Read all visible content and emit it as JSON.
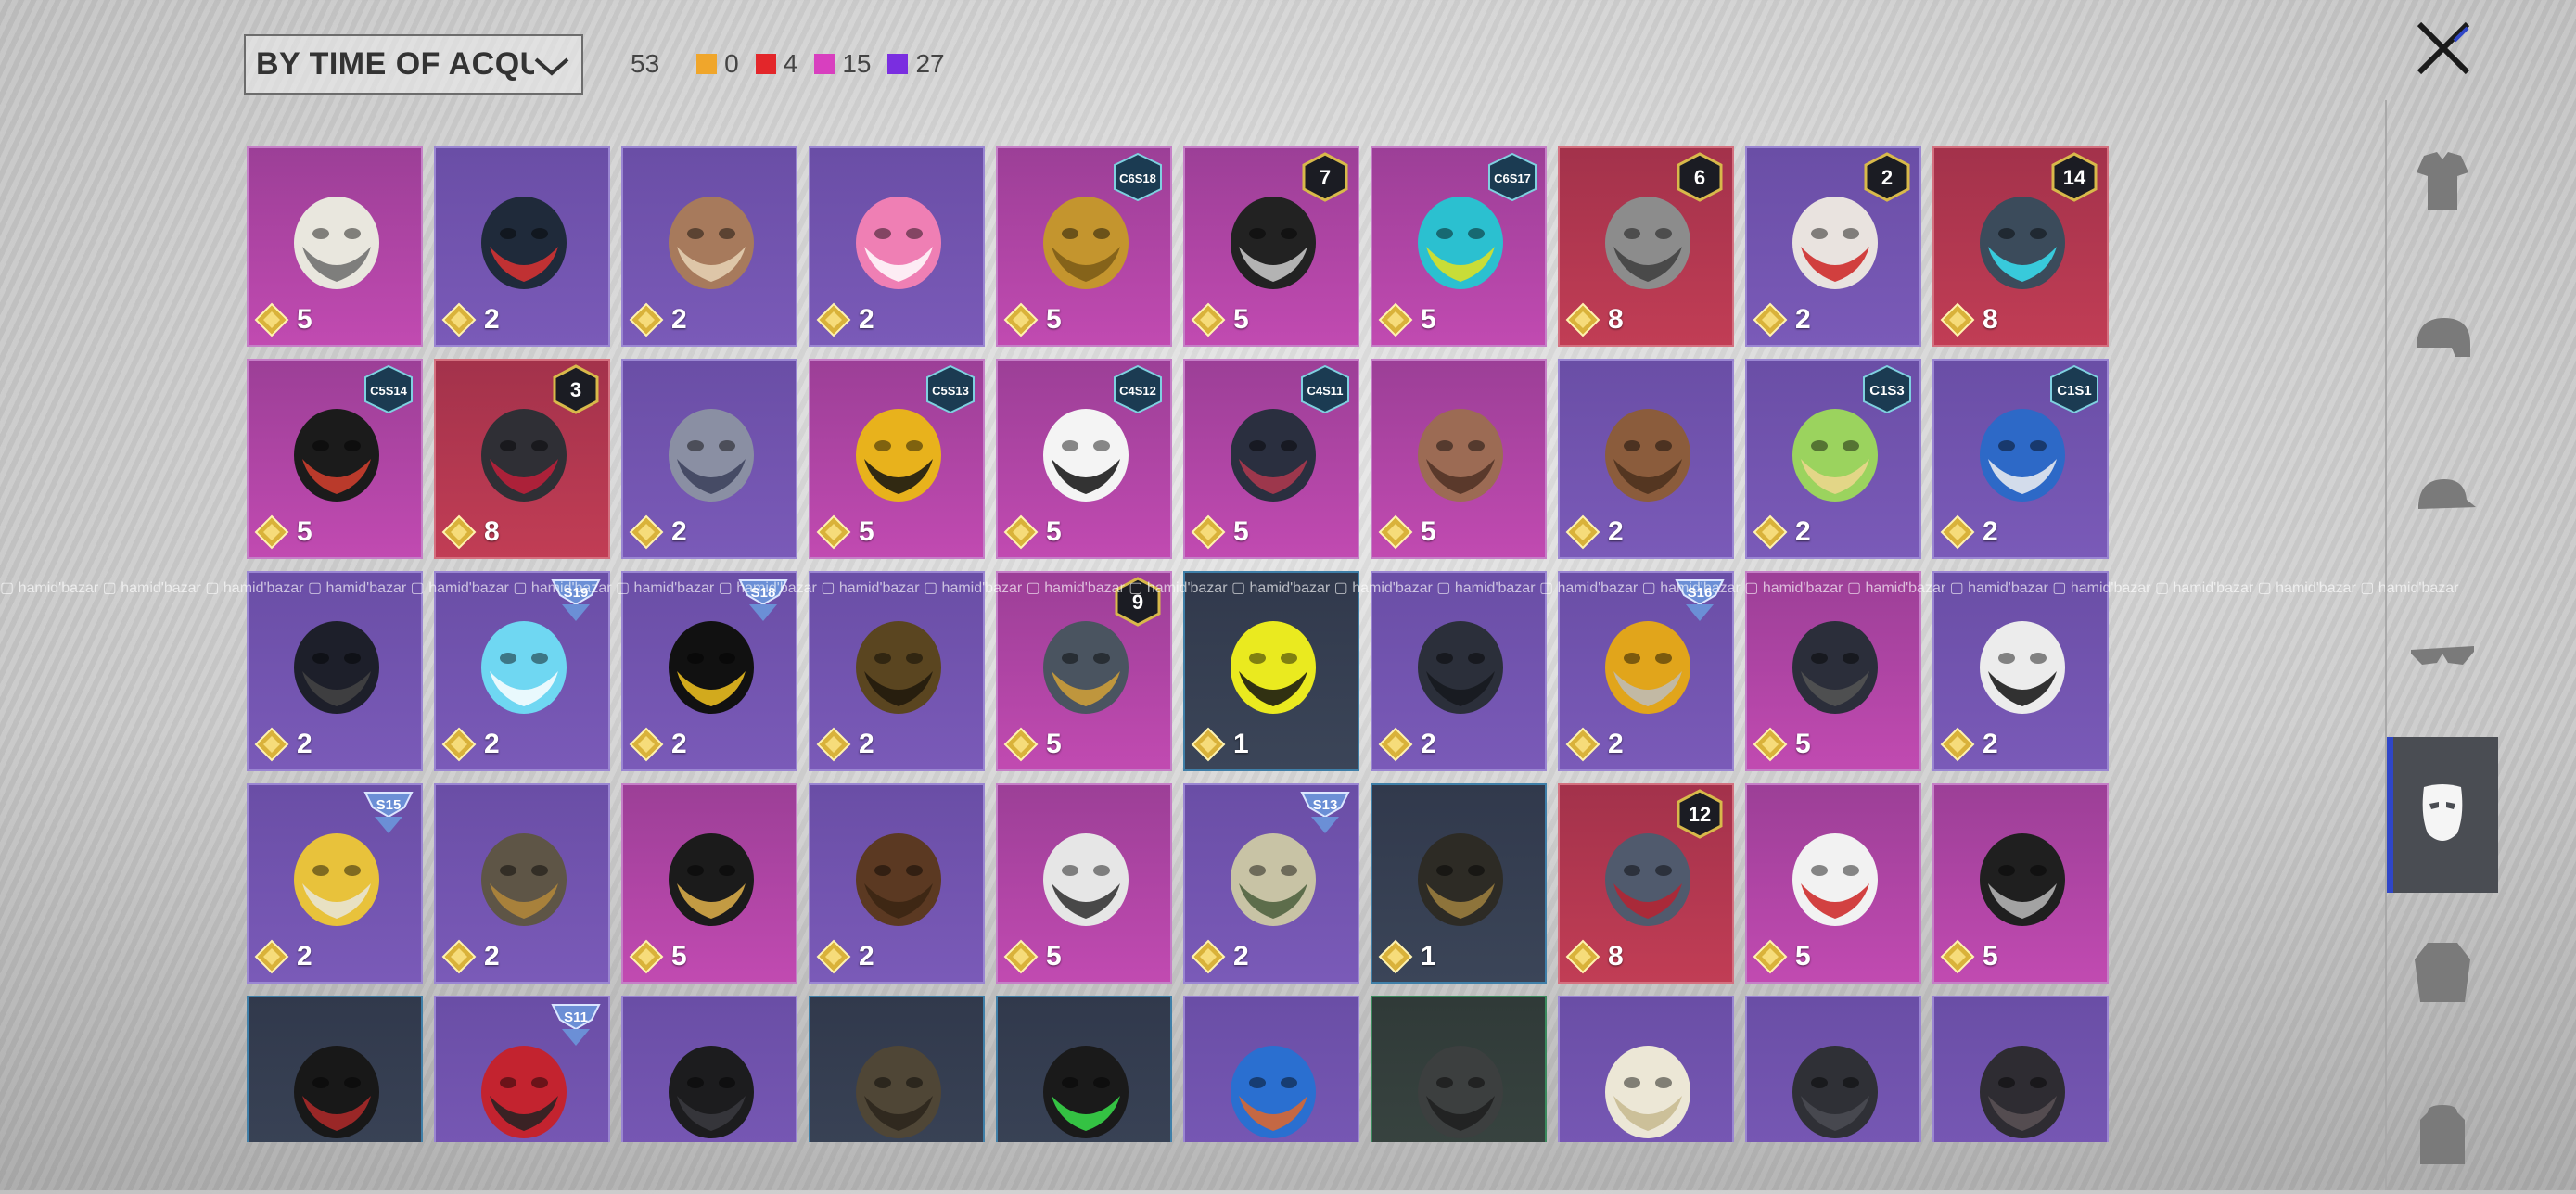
{
  "sort": {
    "label": "BY TIME OF ACQUISIT"
  },
  "counts": {
    "total": "53",
    "items": [
      {
        "color": "#f0a62b",
        "value": "0"
      },
      {
        "color": "#e3262a",
        "value": "4"
      },
      {
        "color": "#d83fbf",
        "value": "15"
      },
      {
        "color": "#7a2ee0",
        "value": "27"
      }
    ]
  },
  "watermark": "hamid'bazar",
  "items": [
    {
      "rarity": "pink",
      "count": "5",
      "icon": "cat-mask-icon",
      "badge": ""
    },
    {
      "rarity": "purple",
      "count": "2",
      "icon": "gas-mask-icon",
      "badge": ""
    },
    {
      "rarity": "purple",
      "count": "2",
      "icon": "mammoth-mask-icon",
      "badge": ""
    },
    {
      "rarity": "purple",
      "count": "2",
      "icon": "pink-hippo-mask-icon",
      "badge": ""
    },
    {
      "rarity": "pink",
      "count": "5",
      "icon": "gold-face-guard-icon",
      "badge": "C6S18"
    },
    {
      "rarity": "pink",
      "count": "5",
      "icon": "earpiece-icon",
      "badge": "7"
    },
    {
      "rarity": "pink",
      "count": "5",
      "icon": "cyan-visor-mask-icon",
      "badge": "C6S17"
    },
    {
      "rarity": "red",
      "count": "8",
      "icon": "plague-doctor-mask-icon",
      "badge": "6"
    },
    {
      "rarity": "purple",
      "count": "2",
      "icon": "clown-mask-icon",
      "badge": "2"
    },
    {
      "rarity": "red",
      "count": "8",
      "icon": "cyber-helmet-icon",
      "badge": "14"
    },
    {
      "rarity": "pink",
      "count": "5",
      "icon": "black-face-mask-icon",
      "badge": "C5S14"
    },
    {
      "rarity": "red",
      "count": "8",
      "icon": "wolf-head-icon",
      "badge": "3"
    },
    {
      "rarity": "purple",
      "count": "2",
      "icon": "silver-helmet-icon",
      "badge": ""
    },
    {
      "rarity": "pink",
      "count": "5",
      "icon": "graffiti-bandana-icon",
      "badge": "C5S13"
    },
    {
      "rarity": "pink",
      "count": "5",
      "icon": "zigzag-face-mask-icon",
      "badge": "C4S12"
    },
    {
      "rarity": "pink",
      "count": "5",
      "icon": "tactical-half-mask-icon",
      "badge": "C4S11"
    },
    {
      "rarity": "pink",
      "count": "5",
      "icon": "bird-skull-mask-icon",
      "badge": ""
    },
    {
      "rarity": "purple",
      "count": "2",
      "icon": "jaw-mask-icon",
      "badge": ""
    },
    {
      "rarity": "purple",
      "count": "2",
      "icon": "cactus-bandana-icon",
      "badge": "C1S3"
    },
    {
      "rarity": "purple",
      "count": "2",
      "icon": "blue-face-mask-icon",
      "badge": "C1S1"
    },
    {
      "rarity": "purple",
      "count": "2",
      "icon": "black-balaclava-icon",
      "badge": ""
    },
    {
      "rarity": "purple",
      "count": "2",
      "icon": "neon-visor-icon",
      "badge": "S19"
    },
    {
      "rarity": "purple",
      "count": "2",
      "icon": "neon-face-mask-icon",
      "badge": "S18"
    },
    {
      "rarity": "purple",
      "count": "2",
      "icon": "camo-face-mask-icon",
      "badge": ""
    },
    {
      "rarity": "pink",
      "count": "5",
      "icon": "steel-helmet-icon",
      "badge": "9"
    },
    {
      "rarity": "dark",
      "count": "1",
      "icon": "yellow-mesh-bandana-icon",
      "badge": ""
    },
    {
      "rarity": "purple",
      "count": "2",
      "icon": "skull-helmet-icon",
      "badge": ""
    },
    {
      "rarity": "purple",
      "count": "2",
      "icon": "yellow-visor-mask-icon",
      "badge": "S16"
    },
    {
      "rarity": "pink",
      "count": "5",
      "icon": "spiked-mask-icon",
      "badge": ""
    },
    {
      "rarity": "purple",
      "count": "2",
      "icon": "skull-face-mask-icon",
      "badge": ""
    },
    {
      "rarity": "purple",
      "count": "2",
      "icon": "gold-skull-icon",
      "badge": "S15"
    },
    {
      "rarity": "purple",
      "count": "2",
      "icon": "bronze-eye-mask-icon",
      "badge": ""
    },
    {
      "rarity": "pink",
      "count": "5",
      "icon": "respirator-icon",
      "badge": ""
    },
    {
      "rarity": "purple",
      "count": "2",
      "icon": "mustache-icon",
      "badge": ""
    },
    {
      "rarity": "pink",
      "count": "5",
      "icon": "white-hood-mask-icon",
      "badge": ""
    },
    {
      "rarity": "purple",
      "count": "2",
      "icon": "goggles-mask-icon",
      "badge": "S13"
    },
    {
      "rarity": "dark",
      "count": "1",
      "icon": "camo-half-mask-icon",
      "badge": ""
    },
    {
      "rarity": "red",
      "count": "8",
      "icon": "knight-helmet-icon",
      "badge": "12"
    },
    {
      "rarity": "pink",
      "count": "5",
      "icon": "heart-mask-icon",
      "badge": ""
    },
    {
      "rarity": "pink",
      "count": "5",
      "icon": "skull-bandana-icon",
      "badge": ""
    },
    {
      "rarity": "dark",
      "count": "",
      "icon": "black-respirator-icon",
      "badge": ""
    },
    {
      "rarity": "purple",
      "count": "",
      "icon": "red-mouth-guard-icon",
      "badge": "S11"
    },
    {
      "rarity": "purple",
      "count": "",
      "icon": "black-helmet-icon",
      "badge": ""
    },
    {
      "rarity": "dark",
      "count": "",
      "icon": "camo-helmet-icon",
      "badge": ""
    },
    {
      "rarity": "dark",
      "count": "",
      "icon": "green-web-mask-icon",
      "badge": ""
    },
    {
      "rarity": "purple",
      "count": "",
      "icon": "blue-bandana-icon",
      "badge": ""
    },
    {
      "rarity": "green",
      "count": "",
      "icon": "grey-gas-mask-icon",
      "badge": ""
    },
    {
      "rarity": "purple",
      "count": "",
      "icon": "white-bandana-icon",
      "badge": ""
    },
    {
      "rarity": "purple",
      "count": "",
      "icon": "riot-helmet-icon",
      "badge": ""
    },
    {
      "rarity": "purple",
      "count": "",
      "icon": "studded-mask-icon",
      "badge": ""
    }
  ],
  "categories": [
    {
      "name": "outfit-icon",
      "active": false
    },
    {
      "name": "helmet-icon",
      "active": false
    },
    {
      "name": "cap-icon",
      "active": false
    },
    {
      "name": "glasses-icon",
      "active": false
    },
    {
      "name": "mask-icon",
      "active": true
    },
    {
      "name": "jacket-icon",
      "active": false
    },
    {
      "name": "backpack-icon",
      "active": false
    }
  ]
}
